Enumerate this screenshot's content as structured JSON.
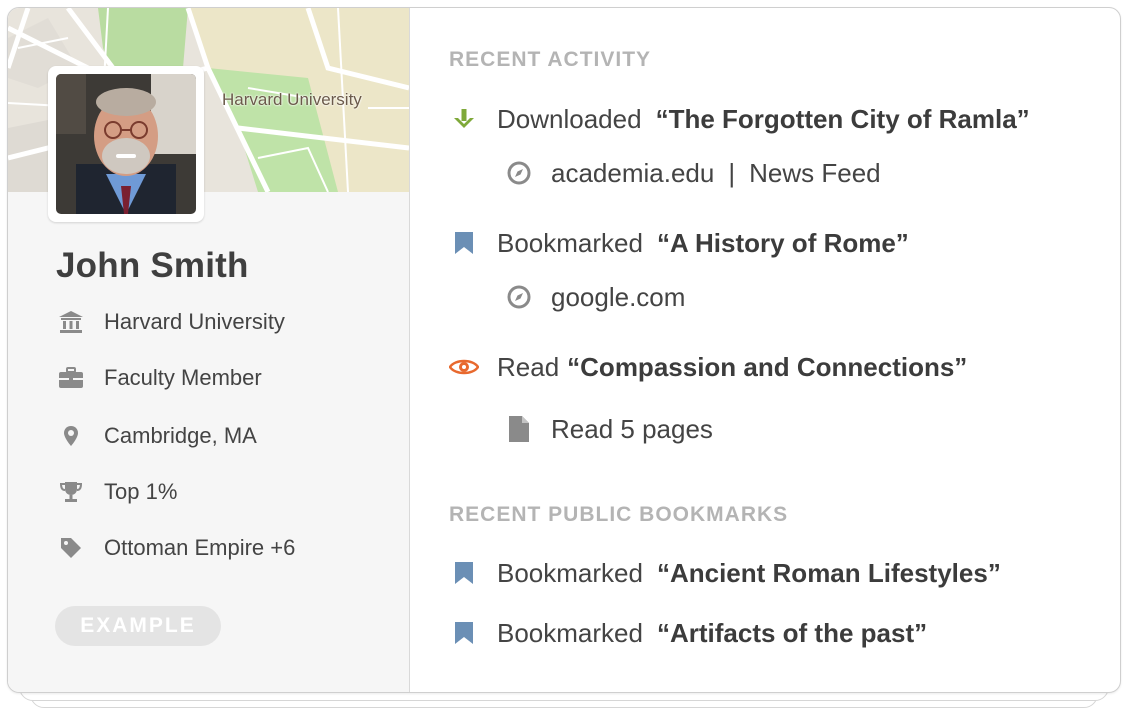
{
  "profile": {
    "map_label": "Harvard University",
    "name": "John Smith",
    "details": [
      {
        "icon": "institution-icon",
        "text": "Harvard University"
      },
      {
        "icon": "briefcase-icon",
        "text": "Faculty Member"
      },
      {
        "icon": "location-pin-icon",
        "text": "Cambridge, MA"
      },
      {
        "icon": "trophy-icon",
        "text": "Top 1%"
      },
      {
        "icon": "tag-icon",
        "text": "Ottoman Empire +6"
      }
    ],
    "badge": "EXAMPLE"
  },
  "recent_activity": {
    "heading": "RECENT ACTIVITY",
    "items": [
      {
        "icon": "download-arrow-icon",
        "verb": "Downloaded",
        "title": "“The Forgotten City of Ramla”",
        "detail_icon": "compass-icon",
        "detail": "academia.edu",
        "detail_extra": "News Feed",
        "separator": "|"
      },
      {
        "icon": "bookmark-icon",
        "verb": "Bookmarked",
        "title": "“A History of Rome”",
        "detail_icon": "compass-icon",
        "detail": "google.com"
      },
      {
        "icon": "eye-icon",
        "verb": "Read",
        "title": "“Compassion and Connections”",
        "detail_icon": "document-icon",
        "detail": "Read 5 pages"
      }
    ]
  },
  "public_bookmarks": {
    "heading": "RECENT PUBLIC BOOKMARKS",
    "items": [
      {
        "icon": "bookmark-icon",
        "verb": "Bookmarked",
        "title": "“Ancient Roman Lifestyles”"
      },
      {
        "icon": "bookmark-icon",
        "verb": "Bookmarked",
        "title": "“Artifacts of the past”"
      }
    ]
  },
  "colors": {
    "download_green": "#7fa93a",
    "bookmark_blue": "#6b8fb5",
    "eye_orange": "#e8692e",
    "icon_gray": "#8a8a8a",
    "heading_gray": "#b4b4b4"
  }
}
